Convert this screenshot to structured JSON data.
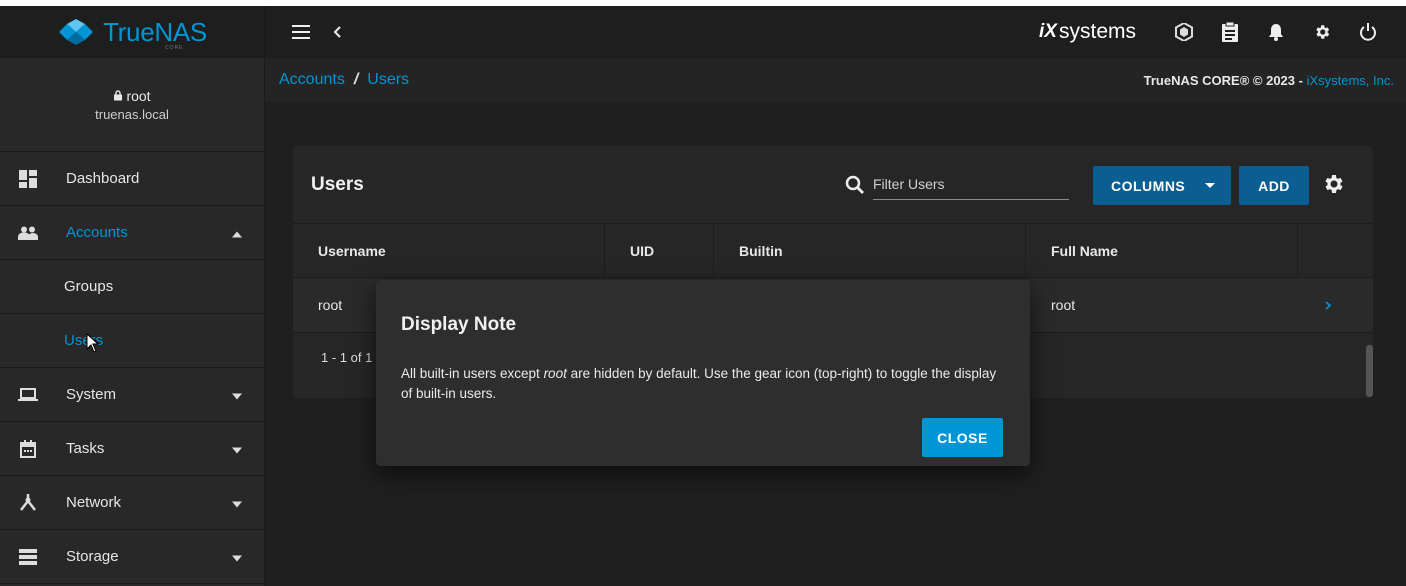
{
  "brand": {
    "logo_text": "TrueNAS",
    "logo_sub": "CORE",
    "vendor_mark": "iX",
    "vendor_text": "systems"
  },
  "user": {
    "name": "root",
    "host": "truenas.local"
  },
  "sidebar": {
    "items": [
      {
        "label": "Dashboard",
        "icon": "dashboard-icon"
      },
      {
        "label": "Accounts",
        "icon": "people-icon",
        "expanded": true
      },
      {
        "label": "Groups",
        "sub": true
      },
      {
        "label": "Users",
        "sub": true,
        "active": true
      },
      {
        "label": "System",
        "icon": "laptop-icon"
      },
      {
        "label": "Tasks",
        "icon": "calendar-icon"
      },
      {
        "label": "Network",
        "icon": "network-icon"
      },
      {
        "label": "Storage",
        "icon": "storage-icon"
      }
    ]
  },
  "breadcrumb": {
    "parent": "Accounts",
    "separator": "/",
    "current": "Users"
  },
  "copyright": {
    "text": "TrueNAS CORE® © 2023 - ",
    "link": "iXsystems, Inc."
  },
  "users_card": {
    "title": "Users",
    "filter_placeholder": "Filter Users",
    "columns_button": "COLUMNS",
    "add_button": "ADD",
    "columns": [
      "Username",
      "UID",
      "Builtin",
      "Full Name"
    ],
    "rows": [
      {
        "username": "root",
        "uid": "",
        "builtin": "",
        "full_name": "root"
      }
    ],
    "pager": "1 - 1 of 1"
  },
  "dialog": {
    "title": "Display Note",
    "body_before": "All built-in users except ",
    "body_emphasis": "root",
    "body_after": " are hidden by default. Use the gear icon (top-right) to toggle the display of built-in users.",
    "close_button": "CLOSE"
  },
  "colors": {
    "accent": "#0095d5",
    "button_blue": "#0b5e91",
    "background": "#1f1f1f"
  }
}
